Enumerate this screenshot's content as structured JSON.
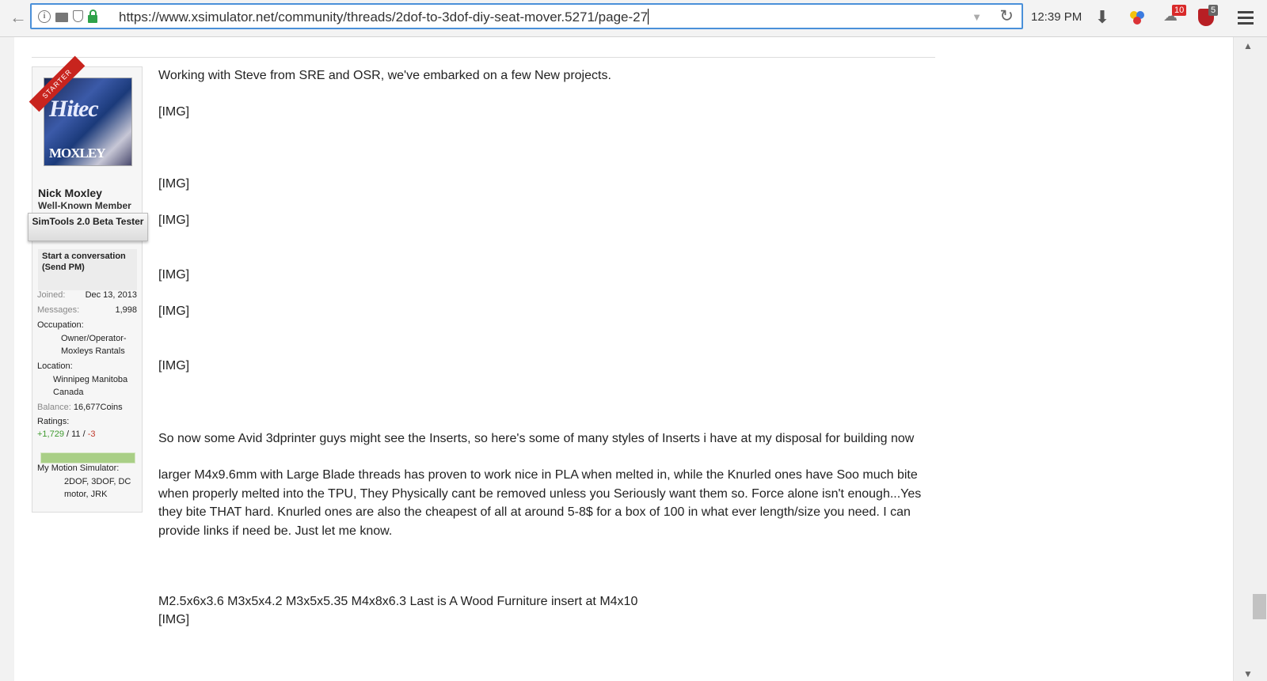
{
  "browser": {
    "url": "https://www.xsimulator.net/community/threads/2dof-to-3dof-diy-seat-mover.5271/page-27",
    "clock": "12:39 PM",
    "badge_ext": "10",
    "badge_ublock": "5"
  },
  "user": {
    "name": "Nick Moxley",
    "title": "Well-Known Member",
    "banner": "SimTools 2.0 Beta Tester",
    "starter_ribbon": "STARTER",
    "send_pm": "Start a conversation (Send PM)",
    "joined_label": "Joined:",
    "joined": "Dec 13, 2013",
    "messages_label": "Messages:",
    "messages": "1,998",
    "occupation_label": "Occupation:",
    "occupation": "Owner/Operator-Moxleys Rantals",
    "location_label": "Location:",
    "location": "Winnipeg Manitoba Canada",
    "balance_label": "Balance:",
    "balance": "16,677Coins",
    "ratings_label": "Ratings:",
    "ratings_pos": "+1,729",
    "ratings_sep1": " / ",
    "ratings_neutral": "11",
    "ratings_sep2": " / ",
    "ratings_neg": "-3",
    "motion_label": "My Motion Simulator:",
    "motion": "2DOF, 3DOF, DC motor, JRK"
  },
  "message": {
    "intro": "Working with Steve from SRE and OSR, we've embarked on a few New projects.",
    "img": "[IMG]",
    "para1": "So now some Avid 3dprinter guys might see the Inserts, so here's some of many styles of Inserts i have at my disposal for building now",
    "para2": "larger M4x9.6mm with Large Blade threads has proven to work nice in PLA when melted in, while the Knurled ones have Soo much bite when properly melted into the TPU, They Physically cant be removed unless you Seriously want them so. Force alone isn't enough...Yes they bite THAT hard. Knurled ones are also the cheapest of all at around 5-8$ for a box of 100 in what ever length/size you need. I can provide links if need be. Just let me know.",
    "para3": "M2.5x6x3.6 M3x5x4.2 M3x5x5.35 M4x8x6.3 Last is A Wood Furniture insert at M4x10"
  }
}
